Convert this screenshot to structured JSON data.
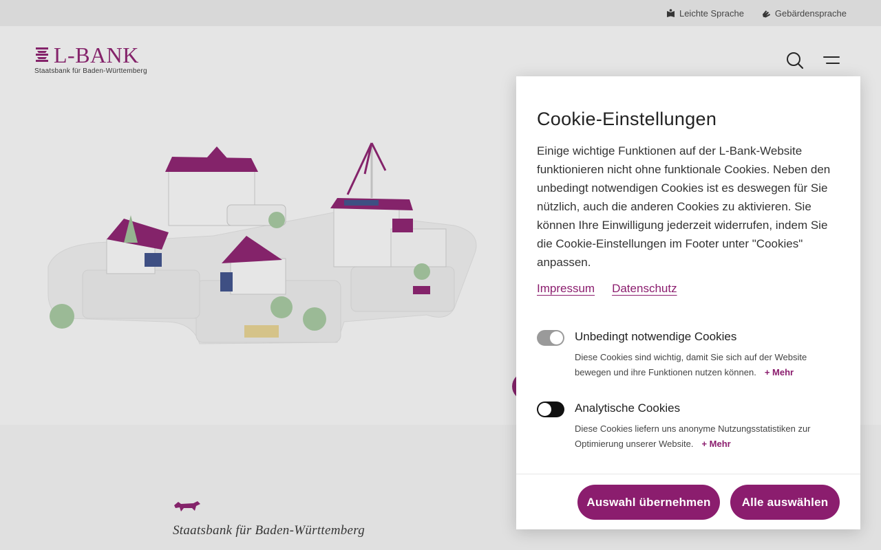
{
  "topbar": {
    "easy_language": "Leichte Sprache",
    "sign_language": "Gebärdensprache"
  },
  "header": {
    "logo_text": "L-BANK",
    "logo_subtitle": "Staatsbank für Baden-Württemberg"
  },
  "footer_brand": {
    "tagline": "Staatsbank für Baden-Württemberg"
  },
  "cookie_modal": {
    "title": "Cookie-Einstellungen",
    "intro": "Einige wichtige Funktionen auf der L-Bank-Website funktionieren nicht ohne funktionale Cookies. Neben den unbedingt notwendigen Cookies ist es deswegen für Sie nützlich, auch die anderen Cookies zu aktivieren. Sie können Ihre Einwilligung jederzeit widerrufen, indem Sie die Cookie-Einstellungen im Footer unter \"Cookies\" anpassen.",
    "links": {
      "imprint": "Impressum",
      "privacy": "Datenschutz"
    },
    "options": [
      {
        "title": "Unbedingt notwendige Cookies",
        "description": "Diese Cookies sind wichtig, damit Sie sich auf der Website bewegen und ihre Funktionen nutzen können.",
        "more": "+ Mehr",
        "enabled": true
      },
      {
        "title": "Analytische Cookies",
        "description": "Diese Cookies liefern uns anonyme Nutzungsstatistiken zur Optimierung unserer Website.",
        "more": "+ Mehr",
        "enabled": false
      }
    ],
    "buttons": {
      "save_selection": "Auswahl übernehmen",
      "select_all": "Alle auswählen"
    }
  },
  "colors": {
    "brand": "#8b1d6e",
    "toggle_on": "#9a9a9a",
    "toggle_off": "#111111"
  }
}
